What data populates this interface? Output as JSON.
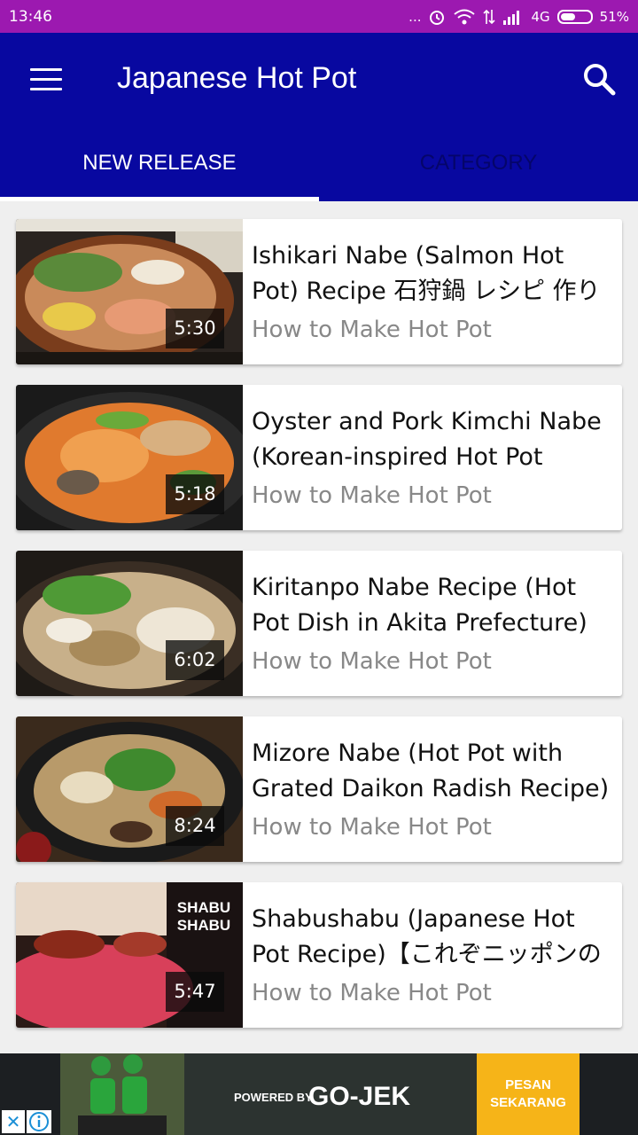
{
  "status_bar": {
    "time": "13:46",
    "dots": "...",
    "network": "4G",
    "battery": "51%",
    "battery_level": 0.51
  },
  "app_bar": {
    "title": "Japanese Hot Pot",
    "menu_icon": "hamburger-menu-icon",
    "search_icon": "search-icon",
    "color": "#0808a0"
  },
  "tabs": [
    {
      "label": "NEW RELEASE",
      "active": true
    },
    {
      "label": "CATEGORY",
      "active": false
    }
  ],
  "videos": [
    {
      "title_line1": "Ishikari Nabe (Salmon Hot",
      "title_line2": "Pot) Recipe 石狩鍋 レシピ 作り",
      "channel": "How to Make Hot Pot",
      "duration": "5:30"
    },
    {
      "title_line1": "Oyster and Pork Kimchi Nabe",
      "title_line2": "(Korean-inspired Hot Pot",
      "channel": "How to Make Hot Pot",
      "duration": "5:18"
    },
    {
      "title_line1": "Kiritanpo Nabe Recipe (Hot",
      "title_line2": "Pot Dish in Akita Prefecture)",
      "channel": "How to Make Hot Pot",
      "duration": "6:02"
    },
    {
      "title_line1": "Mizore Nabe (Hot Pot with",
      "title_line2": "Grated Daikon Radish Recipe)",
      "channel": "How to Make Hot Pot",
      "duration": "8:24"
    },
    {
      "title_line1": "Shabushabu (Japanese Hot",
      "title_line2": "Pot Recipe)【これぞニッポンの",
      "channel": "How to Make Hot Pot",
      "duration": "5:47",
      "thumb_text": "SHABU SHABU"
    }
  ],
  "ad": {
    "powered_by": "POWERED BY",
    "brand": "GO-JEK",
    "cta_line1": "PESAN",
    "cta_line2": "SEKARANG",
    "close": "✕"
  }
}
